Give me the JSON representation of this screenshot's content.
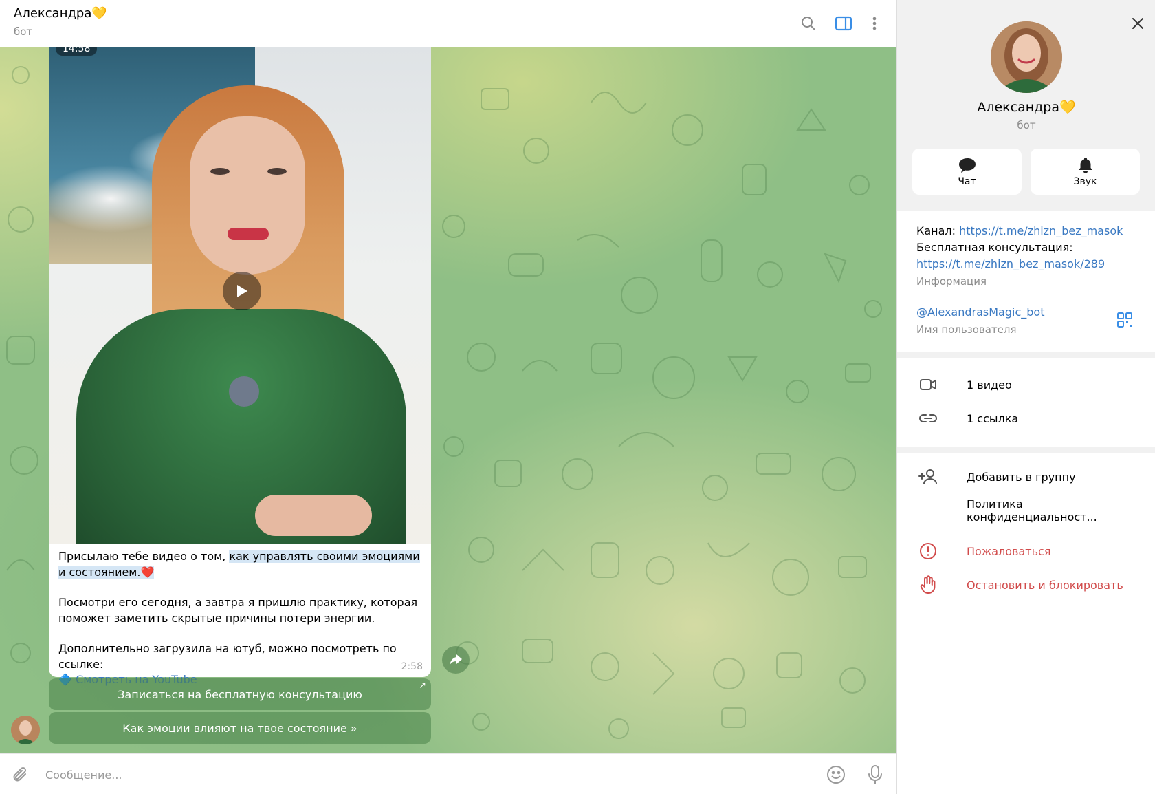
{
  "chat": {
    "title": "Александра",
    "title_emoji": "💛",
    "status": "бот",
    "video_time_badge": "14:58",
    "caption": {
      "line1_plain": "Присылаю тебе видео о том, ",
      "line1_highlight": "как управлять своими эмоциями и состоянием.",
      "line1_emoji": "❤️",
      "para2": "Посмотри его сегодня, а завтра я пришлю практику, которая поможет заметить скрытые причины потери энергии.",
      "para3": "Дополнительно загрузила на ютуб, можно посмотреть по ссылке:",
      "link_marker": "🔷",
      "link_text": "Смотреть на YouTube",
      "time": "2:58"
    },
    "buttons": [
      {
        "label": "Записаться на бесплатную консультацию",
        "arrow": "↗"
      },
      {
        "label": "Как эмоции влияют на твое состояние »"
      }
    ],
    "composer_placeholder": "Сообщение..."
  },
  "profile": {
    "name": "Александра",
    "name_emoji": "💛",
    "role": "бот",
    "actions": [
      {
        "label": "Чат",
        "icon": "chat-bubble-icon"
      },
      {
        "label": "Звук",
        "icon": "bell-icon"
      }
    ],
    "bio": {
      "channel_label": "Канал: ",
      "channel_link": "https://t.me/zhizn_bez_masok",
      "consult_label": "Бесплатная консультация:",
      "consult_link": "https://t.me/zhizn_bez_masok/289",
      "caption": "Информация"
    },
    "username": "@AlexandrasMagic_bot",
    "username_caption": "Имя пользователя",
    "media": [
      {
        "label": "1 видео",
        "icon": "video-camera-icon"
      },
      {
        "label": "1 ссылка",
        "icon": "link-icon"
      }
    ],
    "menu": [
      {
        "label": "Добавить в группу",
        "icon": "add-user-icon"
      },
      {
        "label": "Политика конфиденциальност..."
      },
      {
        "label": "Пожаловаться",
        "icon": "report-icon"
      },
      {
        "label": "Остановить и блокировать",
        "icon": "stop-hand-icon"
      }
    ]
  },
  "colors": {
    "accent": "#3a79c2",
    "danger": "#d14b4b",
    "highlight": "#d5e6f5",
    "bot_button": "#5b9a5b"
  }
}
